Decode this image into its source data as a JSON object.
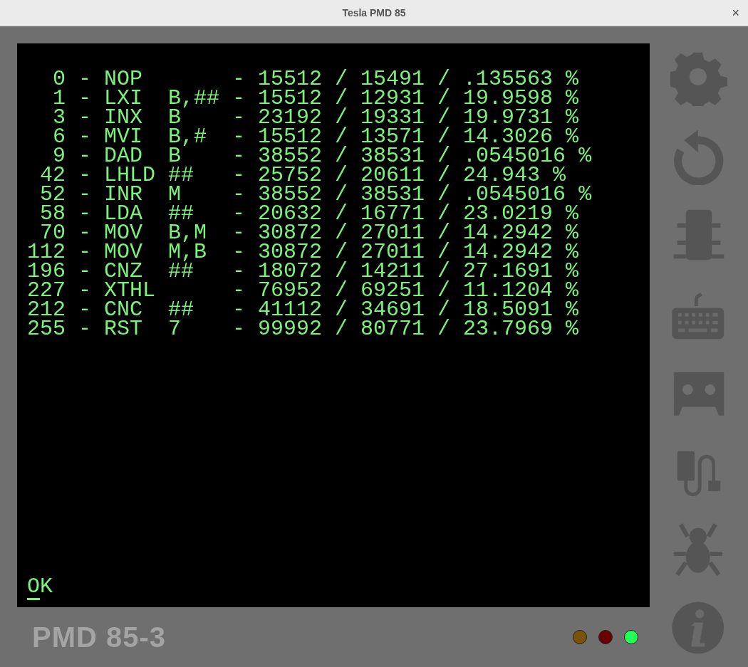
{
  "window": {
    "title": "Tesla PMD 85",
    "close": "×"
  },
  "screen": {
    "lines": [
      "  0 - NOP       - 15512 / 15491 / .135563 %",
      "  1 - LXI  B,## - 15512 / 12931 / 19.9598 %",
      "  3 - INX  B    - 23192 / 19331 / 19.9731 %",
      "  6 - MVI  B,#  - 15512 / 13571 / 14.3026 %",
      "  9 - DAD  B    - 38552 / 38531 / .0545016 %",
      " 42 - LHLD ##   - 25752 / 20611 / 24.943 %",
      " 52 - INR  M    - 38552 / 38531 / .0545016 %",
      " 58 - LDA  ##   - 20632 / 16771 / 23.0219 %",
      " 70 - MOV  B,M  - 30872 / 27011 / 14.2942 %",
      "112 - MOV  M,B  - 30872 / 27011 / 14.2942 %",
      "196 - CNZ  ##   - 18072 / 14211 / 27.1691 %",
      "227 - XTHL      - 76952 / 69251 / 11.1204 %",
      "212 - CNC  ##   - 41112 / 34691 / 18.5091 %",
      "255 - RST  7    - 99992 / 80771 / 23.7969 %"
    ],
    "prompt": "OK"
  },
  "logo": "PMD 85-3",
  "leds": [
    {
      "color": "#7a5208"
    },
    {
      "color": "#6a0000"
    },
    {
      "color": "#22ff55"
    }
  ],
  "toolbar": [
    {
      "kind": "gear"
    },
    {
      "kind": "reset"
    },
    {
      "kind": "chip"
    },
    {
      "kind": "keyboard"
    },
    {
      "kind": "cassette"
    },
    {
      "kind": "cable"
    },
    {
      "kind": "bug"
    },
    {
      "kind": "info"
    }
  ]
}
